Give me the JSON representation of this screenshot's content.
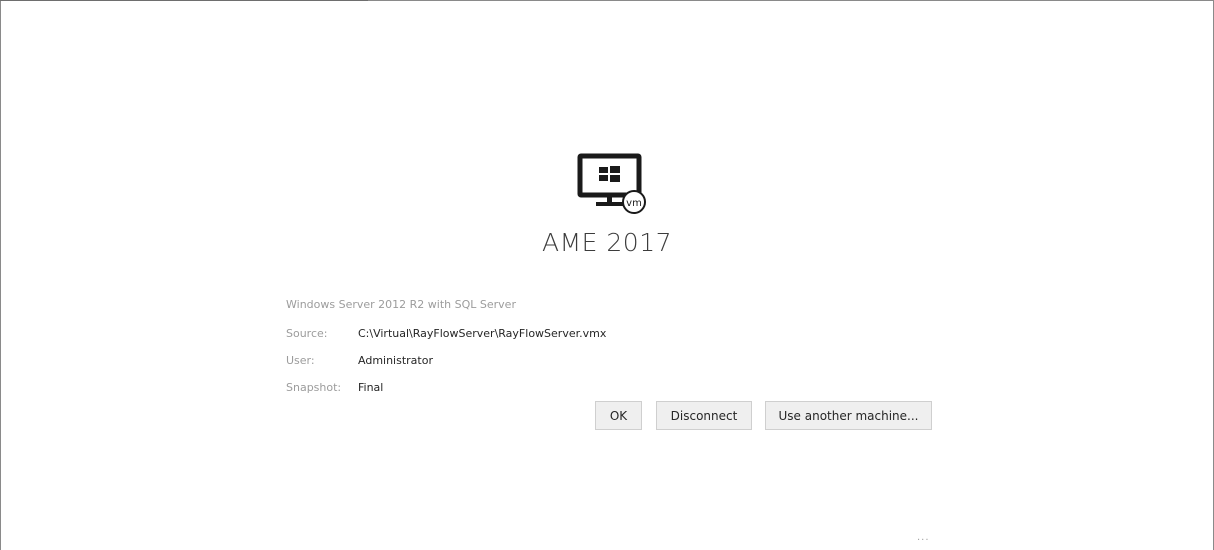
{
  "machine": {
    "name": "AME 2017",
    "os": "Windows Server 2012 R2 with SQL Server",
    "icon": "vm-monitor-icon"
  },
  "details": {
    "source_label": "Source:",
    "source_value": "C:\\Virtual\\RayFlowServer\\RayFlowServer.vmx",
    "user_label": "User:",
    "user_value": "Administrator",
    "snapshot_label": "Snapshot:",
    "snapshot_value": "Final"
  },
  "buttons": {
    "ok": "OK",
    "disconnect": "Disconnect",
    "use_another": "Use another machine..."
  },
  "more": "...",
  "colors": {
    "text": "#262626",
    "label": "#9c9c9c",
    "button_bg": "#efefef",
    "button_border": "#cfcfcf"
  }
}
